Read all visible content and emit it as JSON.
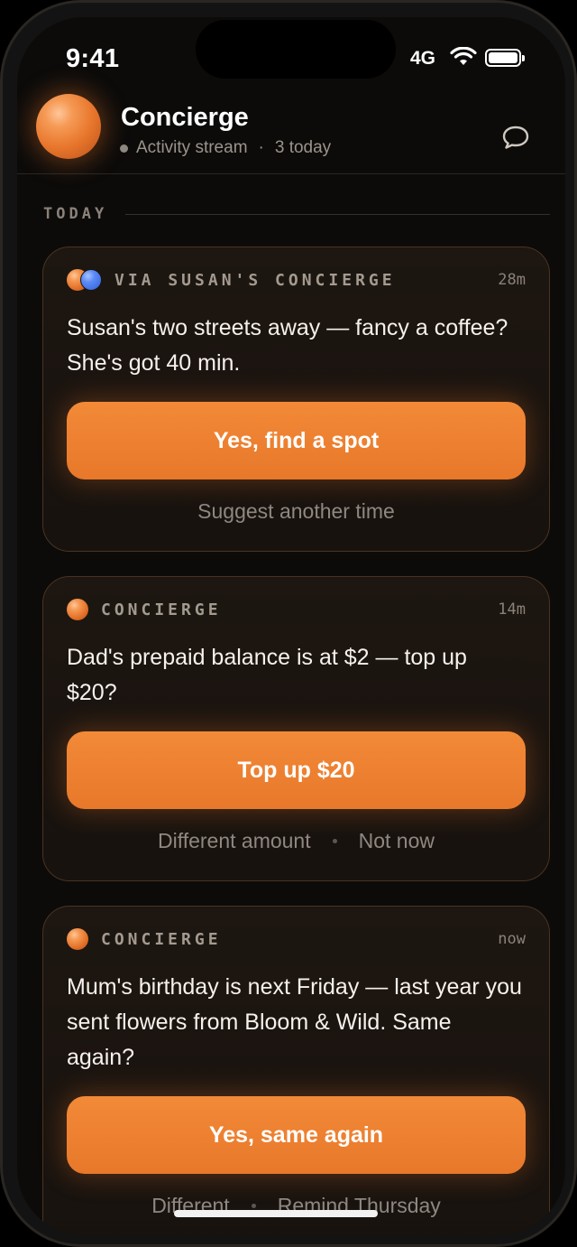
{
  "status_bar": {
    "time": "9:41",
    "network": "4G"
  },
  "header": {
    "title": "Concierge",
    "subtitle": "Activity stream",
    "count": "3 today"
  },
  "section": {
    "label": "TODAY"
  },
  "cards": [
    {
      "source": "VIA SUSAN'S CONCIERGE",
      "time": "28m",
      "message": "Susan's two streets away — fancy a coffee? She's got 40 min.",
      "primary": "Yes, find a spot",
      "secondary": [
        "Suggest another time"
      ]
    },
    {
      "source": "CONCIERGE",
      "time": "14m",
      "message": "Dad's prepaid balance is at $2 — top up $20?",
      "primary": "Top up $20",
      "secondary": [
        "Different amount",
        "Not now"
      ]
    },
    {
      "source": "CONCIERGE",
      "time": "now",
      "message": "Mum's birthday is next Friday — last year you sent flowers from Bloom & Wild. Same again?",
      "primary": "Yes, same again",
      "secondary": [
        "Different",
        "Remind Thursday"
      ]
    }
  ],
  "colors": {
    "accent": "#ee7f31",
    "background": "#0c0b0a",
    "card_border": "#4a3321"
  }
}
